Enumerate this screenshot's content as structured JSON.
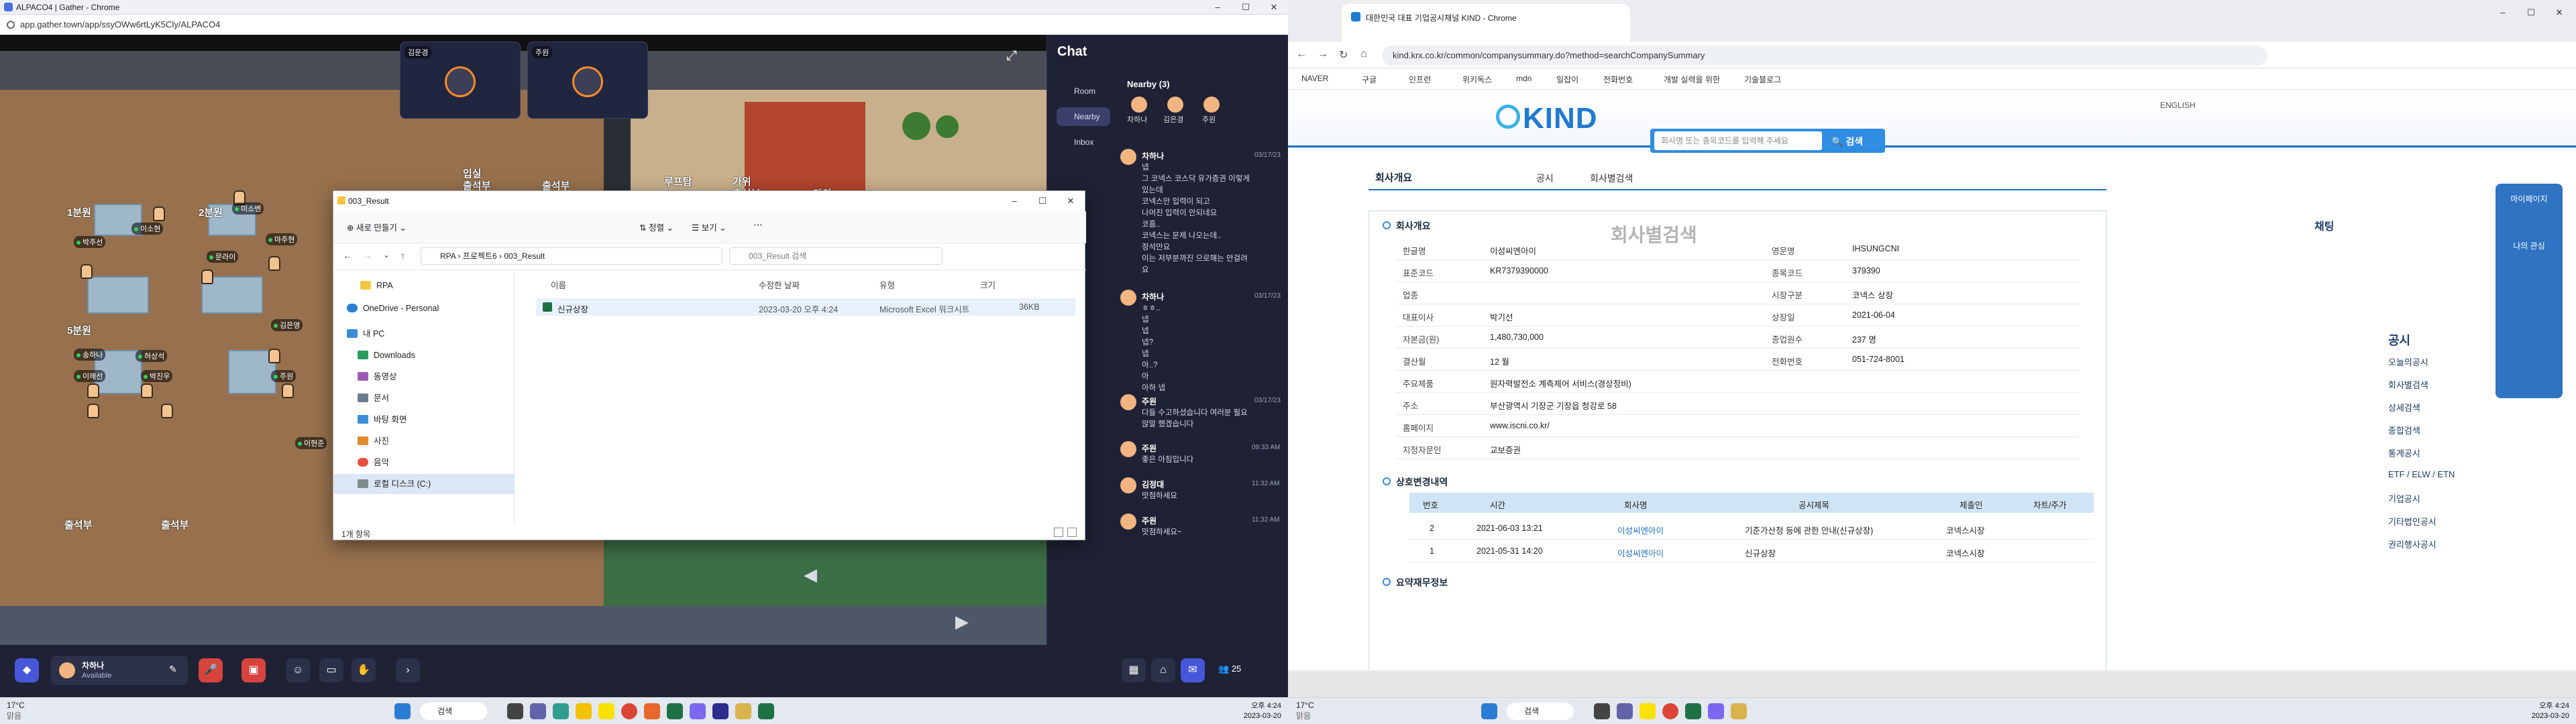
{
  "left_window": {
    "title": "ALPACO4 | Gather - Chrome",
    "url": "app.gather.town/app/ssyOWw6rtLyK5Cly/ALPACO4"
  },
  "gather": {
    "video_tiles": [
      "김운경",
      "주원"
    ],
    "map_labels": {
      "room1": "1분원",
      "room2": "2분원",
      "room5": "5분원",
      "wall_top": "출석부",
      "wall_top2": "출석부",
      "wall_top3": "출석부",
      "wall_bottom": "출석부",
      "wall_bottom2": "출석부",
      "sign1": "입실",
      "sign2": "가위",
      "sign3": "루프탑",
      "sign4": "가위"
    },
    "avatars": [
      "이소현",
      "미소벤",
      "박주선",
      "문라이",
      "마주현",
      "송하나",
      "허상석",
      "이해선",
      "박진우",
      "김은영",
      "주원",
      "이현준"
    ],
    "bottom": {
      "user_name": "차하나",
      "status": "Available",
      "participants": "25"
    }
  },
  "chat": {
    "title": "Chat",
    "nav": [
      "Room",
      "Nearby",
      "Inbox"
    ],
    "nearby_title": "Nearby (3)",
    "nearby_people": [
      "차하나",
      "김은경",
      "주원"
    ],
    "messages": [
      {
        "name": "차하나",
        "time": "03/17/23",
        "text": "넵\n그 코넥스 코스닥 유가증권 이렇게\n있는데\n코넥스만 입력이 되고\n나머진 입력이 안되네요\n코흠..\n코넥스는 문제 나오는데..\n정석만요\n이는 저부분까진 으로해는 안걸려\n요"
      },
      {
        "name": "차하나",
        "time": "03/17/23",
        "text": "ㅎㅎ..\n넵\n넵\n넵?\n넵\n아..?\n아\n아하 넵"
      },
      {
        "name": "주원",
        "time": "03/17/23",
        "text": "다들 수고하셨습니다 여러분 필요\n않말 했겠습니다"
      },
      {
        "name": "주원",
        "time": "09:33 AM",
        "text": "좋은 아침입니다"
      },
      {
        "name": "김정대",
        "time": "11:32 AM",
        "text": "맛점하세요"
      },
      {
        "name": "주원",
        "time": "11:32 AM",
        "text": "맛점하세요~"
      }
    ]
  },
  "explorer": {
    "title": "003_Result",
    "new_button": "새로 만들기",
    "sort_button": "정렬",
    "view_button": "보기",
    "path": [
      "RPA",
      "프로젝트6",
      "003_Result"
    ],
    "search_placeholder": "003_Result 검색",
    "sidebar": [
      "RPA",
      "OneDrive - Personal",
      "내 PC",
      "Downloads",
      "동영상",
      "문서",
      "바탕 화면",
      "사진",
      "음악",
      "로컬 디스크 (C:)"
    ],
    "columns": [
      "이름",
      "수정한 날짜",
      "유형",
      "크기"
    ],
    "file": {
      "name": "신규상장",
      "date": "2023-03-20 오후 4:24",
      "type": "Microsoft Excel 워크시트",
      "size": "36KB"
    },
    "status": "1개 항목"
  },
  "right_window": {
    "title": "대한민국 대표 기업공시채널 KIND - Chrome",
    "url": "kind.krx.co.kr/common/companysummary.do?method=searchCompanySummary",
    "bookmarks": [
      "NAVER",
      "구글",
      "인프런",
      "위키독스",
      "mdn",
      "일잡이",
      "전화번호",
      "개발 실력을 위한",
      "기술블로그"
    ]
  },
  "kind": {
    "logo": "KIND",
    "search_placeholder": "회사명 또는 종목코드를 입력해 주세요",
    "search_button": "검색",
    "tabs": [
      "회사개요",
      "공시",
      "회사별검색"
    ],
    "section1": "회사개요",
    "info": [
      [
        "한글명",
        "이성씨엔아이",
        "영문명",
        "IHSUNGCNI"
      ],
      [
        "표준코드",
        "KR7379390000",
        "종목코드",
        "379390"
      ],
      [
        "업종",
        "",
        "시장구분",
        "코넥스 상장"
      ],
      [
        "대표이사",
        "박기선",
        "상장일",
        "2021-06-04"
      ],
      [
        "자본금(원)",
        "1,480,730,000",
        "종업원수",
        "237 명"
      ],
      [
        "결산월",
        "12 월",
        "전화번호",
        "051-724-8001"
      ],
      [
        "주요제품",
        "원자력발전소 계측제어 서비스(경상정비)",
        "",
        ""
      ],
      [
        "주소",
        "부산광역시 기장군 기장읍 청강로 58",
        "",
        ""
      ],
      [
        "홈페이지",
        "www.iscni.co.kr/",
        "",
        ""
      ],
      [
        "지정자문인",
        "교보증권",
        "",
        ""
      ]
    ],
    "section2": "상호변경내역",
    "history_columns": [
      "번호",
      "시간",
      "회사명",
      "공시제목",
      "제출인",
      "차트/주가"
    ],
    "history": [
      [
        "2",
        "2021-06-03 13:21",
        "이성씨엔아이",
        "기준가산정 등에 관한 안내(신규상장)",
        "코넥스시장"
      ],
      [
        "1",
        "2021-05-31 14:20",
        "이성씨엔아이",
        "신규상장",
        "코넥스시장"
      ]
    ],
    "section3": "요약재무정보",
    "overlay_title": "회사별검색",
    "right_rail": [
      "마이페이지",
      "나의 관심",
      "채팅",
      "공시",
      "오늘의공시",
      "회사별검색",
      "상세검색",
      "종합검색",
      "통계공시",
      "ETF / ELW / ETN",
      "기업공시",
      "기타법인공시",
      "권리행사공시"
    ]
  },
  "taskbar_left": {
    "weather": "17°C",
    "weather_sub": "맑음",
    "search": "검색",
    "time": "오후 4:24",
    "date": "2023-03-20"
  },
  "taskbar_right": {
    "weather": "17°C",
    "weather_sub": "맑음",
    "search": "검색",
    "time": "오후 4:24",
    "date": "2023-03-20"
  }
}
